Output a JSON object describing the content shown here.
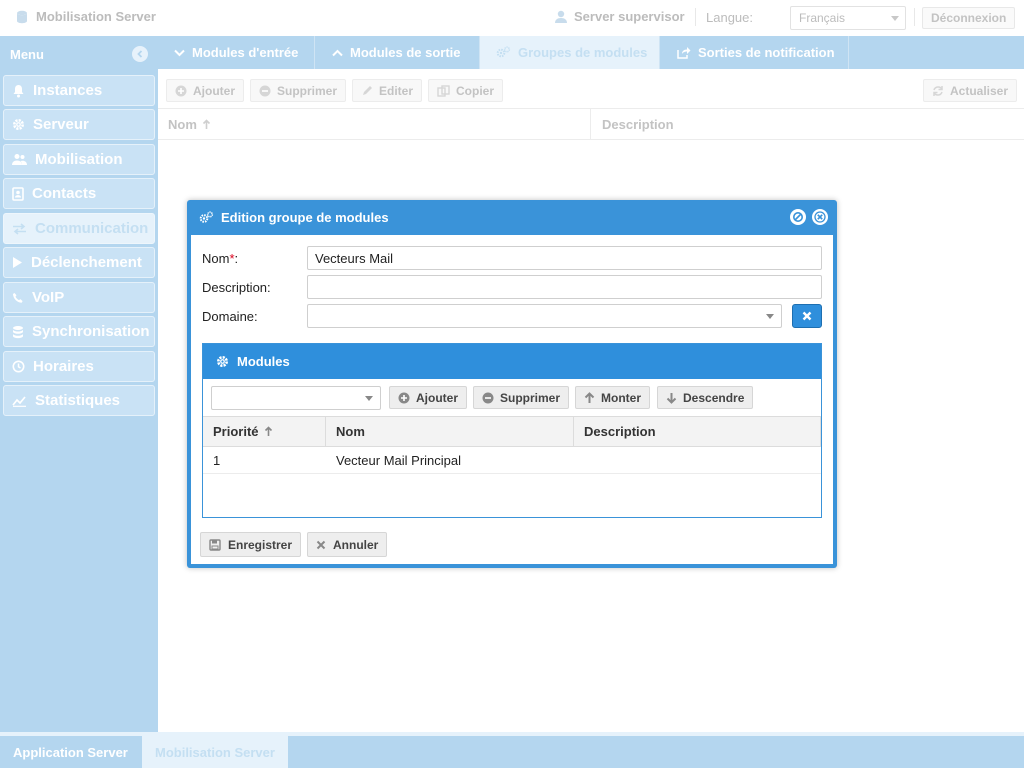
{
  "header": {
    "app_title": "Mobilisation Server",
    "user": "Server supervisor",
    "language_label": "Langue:",
    "language_value": "Français",
    "logout_label": "Déconnexion"
  },
  "sidebar": {
    "title": "Menu",
    "items": [
      {
        "label": "Instances",
        "icon": "bell-icon"
      },
      {
        "label": "Serveur",
        "icon": "gear-icon"
      },
      {
        "label": "Mobilisation",
        "icon": "users-icon"
      },
      {
        "label": "Contacts",
        "icon": "address-book-icon"
      },
      {
        "label": "Communication",
        "icon": "exchange-icon",
        "active": true
      },
      {
        "label": "Déclenchement",
        "icon": "play-icon"
      },
      {
        "label": "VoIP",
        "icon": "phone-icon"
      },
      {
        "label": "Synchronisation",
        "icon": "database-icon"
      },
      {
        "label": "Horaires",
        "icon": "clock-icon"
      },
      {
        "label": "Statistiques",
        "icon": "chart-line-icon"
      }
    ]
  },
  "tabs": [
    {
      "label": "Modules d'entrée",
      "icon": "chevron-down-icon"
    },
    {
      "label": "Modules de sortie",
      "icon": "chevron-up-icon"
    },
    {
      "label": "Groupes de modules",
      "icon": "gears-icon",
      "active": true
    },
    {
      "label": "Sorties de notification",
      "icon": "share-icon"
    }
  ],
  "toolbar": {
    "add": "Ajouter",
    "delete": "Supprimer",
    "edit": "Editer",
    "copy": "Copier",
    "refresh": "Actualiser"
  },
  "grid": {
    "columns": [
      "Nom",
      "Description"
    ]
  },
  "dialog": {
    "title": "Edition groupe de modules",
    "fields": {
      "name_label": "Nom",
      "name_required_mark": "*",
      "name_colon": ":",
      "name_value": "Vecteurs Mail",
      "description_label": "Description:",
      "description_value": "",
      "domain_label": "Domaine:",
      "domain_value": ""
    },
    "modules_panel": {
      "title": "Modules",
      "add": "Ajouter",
      "delete": "Supprimer",
      "up": "Monter",
      "down": "Descendre",
      "columns": [
        "Priorité",
        "Nom",
        "Description"
      ],
      "rows": [
        {
          "priority": "1",
          "name": "Vecteur Mail Principal",
          "description": ""
        }
      ]
    },
    "save": "Enregistrer",
    "cancel": "Annuler"
  },
  "bottom_tabs": [
    {
      "label": "Application Server"
    },
    {
      "label": "Mobilisation Server",
      "active": true
    }
  ],
  "colors": {
    "accent": "#2f8fdc",
    "sidebar_bg": "#b4d6ef",
    "required": "#d9001b"
  }
}
